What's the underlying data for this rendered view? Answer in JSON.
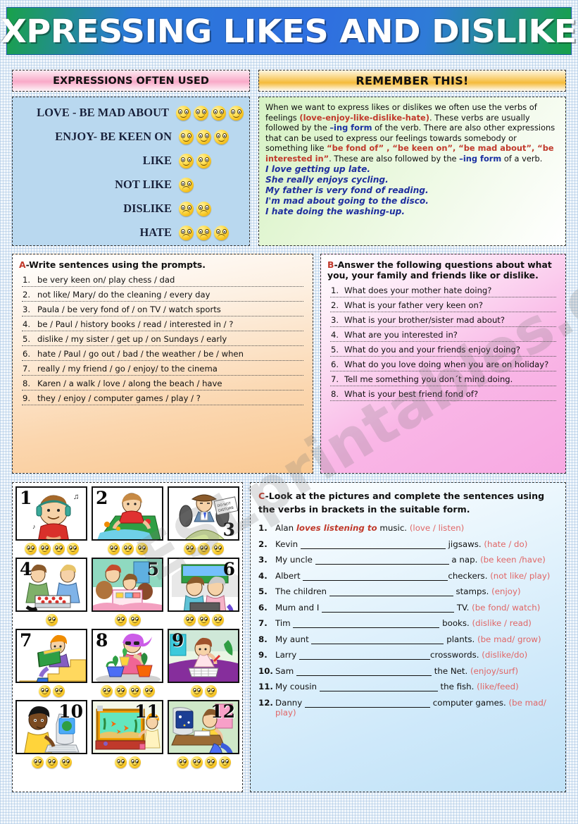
{
  "title": "EXPRESSING LIKES AND DISLIKES",
  "watermark": "ESLprintables.com",
  "headers": {
    "left": "EXPRESSIONS OFTEN USED",
    "right": "REMEMBER THIS!"
  },
  "expressions": [
    {
      "label": "LOVE - BE MAD ABOUT",
      "faces": 4,
      "mood": "happy"
    },
    {
      "label": "ENJOY- BE KEEN ON",
      "faces": 3,
      "mood": "happy"
    },
    {
      "label": "LIKE",
      "faces": 2,
      "mood": "happy"
    },
    {
      "label": "NOT LIKE",
      "faces": 1,
      "mood": "sad"
    },
    {
      "label": "DISLIKE",
      "faces": 2,
      "mood": "sad"
    },
    {
      "label": "HATE",
      "faces": 3,
      "mood": "sad"
    }
  ],
  "remember": {
    "p1_a": "When we want to express likes or dislikes we often use the verbs of feelings ",
    "p1_red1": "(love-enjoy-like-dislike-hate)",
    "p1_b": ". These verbs are usually followed by the ",
    "p1_blue1": "–ing form",
    "p1_c": " of the verb. There are also other expressions that can be used to express our feelings towards somebody or something like ",
    "p1_red2": "“be fond of” , “be keen on”, “be mad about”, “be interested in”",
    "p1_d": ". These are also followed by the ",
    "p1_blue2": "–ing form",
    "p1_e": " of a verb.",
    "examples": [
      "I love getting up late.",
      "She really enjoys cycling.",
      "My father is very fond of reading.",
      "I'm mad about going to the disco.",
      "I hate doing the washing-up."
    ]
  },
  "exercise_a": {
    "letter": "A",
    "title": "-Write sentences using the prompts.",
    "items": [
      {
        "n": "1.",
        "text": "be very keen on/ play chess / dad"
      },
      {
        "n": "2.",
        "text": "not like/ Mary/ do the cleaning / every day"
      },
      {
        "n": "3.",
        "text": "Paula / be very fond of / on TV / watch sports"
      },
      {
        "n": "4.",
        "text": "be / Paul / history  books / read / interested in / ?"
      },
      {
        "n": "5.",
        "text": "dislike / my sister / get up / on Sundays / early"
      },
      {
        "n": "6.",
        "text": "hate / Paul / go out / bad / the weather / be / when"
      },
      {
        "n": "7.",
        "text": "really / my friend / go / enjoy/ to the cinema"
      },
      {
        "n": "8.",
        "text": "Karen / a walk / love / along the beach / have"
      },
      {
        "n": "9.",
        "text": "they / enjoy / computer games / play / ?"
      }
    ]
  },
  "exercise_b": {
    "letter": "B",
    "title": "-Answer the following questions about what you, your family and friends like or dislike.",
    "items": [
      {
        "n": "1.",
        "text": "What does your mother hate doing?"
      },
      {
        "n": "2.",
        "text": "What is your father very keen on?"
      },
      {
        "n": "3.",
        "text": "What is your brother/sister mad about?"
      },
      {
        "n": "4.",
        "text": "What are you interested in?"
      },
      {
        "n": "5.",
        "text": "What do you and your friends enjoy doing?"
      },
      {
        "n": "6.",
        "text": "What do you love doing when you are on holiday?"
      },
      {
        "n": "7.",
        "text": "Tell me something you don´t mind doing."
      },
      {
        "n": "8.",
        "text": "What is your best friend fond of?"
      }
    ]
  },
  "exercise_c": {
    "letter": "C",
    "title": "-Look at the pictures and complete the sentences using the verbs in brackets in the suitable form.",
    "items": [
      {
        "n": "1.",
        "subject": "Alan ",
        "answer": "loves listening to",
        "rest": " music.",
        "hint": "(love / listen)"
      },
      {
        "n": "2.",
        "subject": "Kevin ",
        "answer": "",
        "rest": " jigsaws.",
        "hint": "(hate / do)"
      },
      {
        "n": "3.",
        "subject": "My uncle ",
        "answer": "",
        "rest": " a nap.",
        "hint": "(be keen /have)"
      },
      {
        "n": "4.",
        "subject": "Albert ",
        "answer": "",
        "rest": "checkers.",
        "hint": "(not like/ play)"
      },
      {
        "n": "5.",
        "subject": "The children ",
        "answer": "",
        "rest": " stamps.",
        "hint": "(enjoy)"
      },
      {
        "n": "6.",
        "subject": "Mum and I ",
        "answer": "",
        "rest": " TV.",
        "hint": "(be fond/ watch)"
      },
      {
        "n": "7.",
        "subject": "Tim ",
        "answer": "",
        "rest": " books.",
        "hint": "(dislike / read)"
      },
      {
        "n": "8.",
        "subject": "My aunt ",
        "answer": "",
        "rest": " plants.",
        "hint": "(be mad/ grow)"
      },
      {
        "n": "9.",
        "subject": "Larry ",
        "answer": "",
        "rest": "crosswords.",
        "hint": "(dislike/do)"
      },
      {
        "n": "10.",
        "subject": "Sam ",
        "answer": "",
        "rest": " the Net.",
        "hint": "(enjoy/surf)"
      },
      {
        "n": "11.",
        "subject": "My cousin ",
        "answer": "",
        "rest": " the fish.",
        "hint": "(like/feed)"
      },
      {
        "n": "12.",
        "subject": "Danny ",
        "answer": "",
        "rest": " computer games.",
        "hint": "(be mad/ play)"
      }
    ]
  },
  "pictures": [
    {
      "num": "1",
      "numpos": "tl",
      "faces": 4,
      "caption": "boy-listening-to-music"
    },
    {
      "num": "2",
      "numpos": "tl",
      "faces": 3,
      "caption": "girl-doing-jigsaw"
    },
    {
      "num": "3",
      "numpos": "br",
      "faces": 3,
      "caption": "man-having-a-nap"
    },
    {
      "num": "4",
      "numpos": "tl",
      "faces": 1,
      "caption": "two-boys-playing-checkers"
    },
    {
      "num": "5",
      "numpos": "tr",
      "faces": 2,
      "caption": "children-collecting-stamps"
    },
    {
      "num": "6",
      "numpos": "tr",
      "faces": 3,
      "caption": "family-watching-tv"
    },
    {
      "num": "7",
      "numpos": "tl",
      "faces": 2,
      "caption": "boy-reading-books"
    },
    {
      "num": "8",
      "numpos": "tl",
      "faces": 4,
      "caption": "woman-growing-plants"
    },
    {
      "num": "9",
      "numpos": "tl",
      "faces": 2,
      "caption": "man-doing-crossword"
    },
    {
      "num": "10",
      "numpos": "tr",
      "faces": 3,
      "caption": "boy-surfing-the-net"
    },
    {
      "num": "11",
      "numpos": "tr",
      "faces": 2,
      "caption": "girl-feeding-fish"
    },
    {
      "num": "12",
      "numpos": "tr",
      "faces": 4,
      "caption": "boy-playing-computer-games"
    }
  ],
  "colors": {
    "banner_blue": "#2f6fe0",
    "banner_green": "#19a14a",
    "pink_header": "#f9a9c8",
    "orange_header": "#f5bb3a",
    "expr_bg": "#b9d8ef",
    "accent_red": "#c0392b",
    "accent_blue": "#1a2fa0"
  }
}
